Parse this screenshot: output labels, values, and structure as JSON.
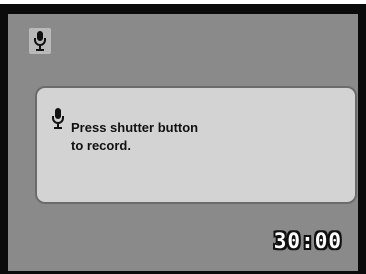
{
  "screen": {
    "status_icon": "microphone-icon",
    "dialog": {
      "icon": "microphone-icon",
      "message": "Press shutter button\nto record."
    },
    "timer": "30:00"
  },
  "colors": {
    "screen_bg": "#8a8a8a",
    "dialog_bg": "#d3d3d3",
    "dialog_border": "#6b6b6b",
    "text": "#111111",
    "timer_fill": "#ffffff",
    "timer_outline": "#111111"
  }
}
